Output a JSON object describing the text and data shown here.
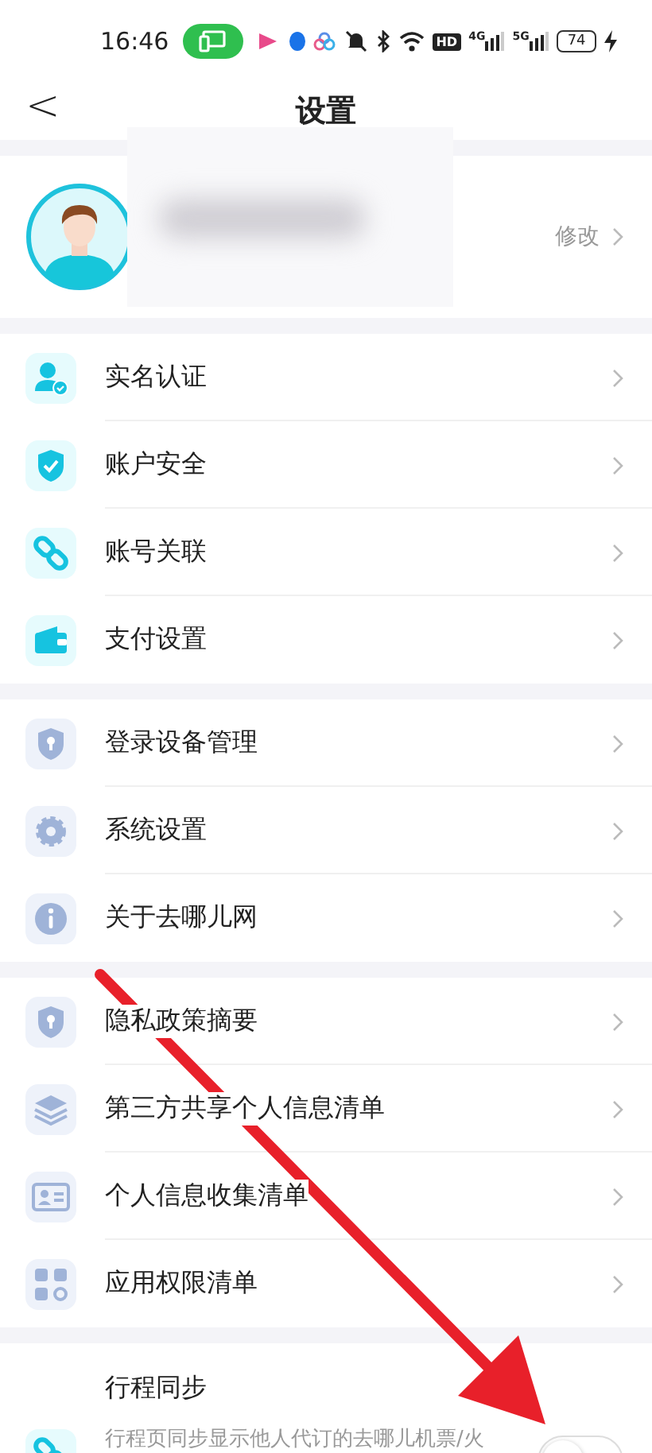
{
  "status_bar": {
    "time": "16:46",
    "hd": "HD",
    "net1": "4G",
    "net2": "5G",
    "battery": "74"
  },
  "header": {
    "back": "<",
    "title": "设置"
  },
  "profile": {
    "edit": "修改"
  },
  "groups": [
    {
      "items": [
        {
          "label": "实名认证"
        },
        {
          "label": "账户安全"
        },
        {
          "label": "账号关联"
        },
        {
          "label": "支付设置"
        }
      ]
    },
    {
      "items": [
        {
          "label": "登录设备管理"
        },
        {
          "label": "系统设置"
        },
        {
          "label": "关于去哪儿网"
        }
      ]
    },
    {
      "items": [
        {
          "label": "隐私政策摘要"
        },
        {
          "label": "第三方共享个人信息清单"
        },
        {
          "label": "个人信息收集清单"
        },
        {
          "label": "应用权限清单"
        }
      ]
    }
  ],
  "sync": {
    "title": "行程同步",
    "description": "行程页同步显示他人代订的去哪儿机票/火",
    "on": false
  }
}
